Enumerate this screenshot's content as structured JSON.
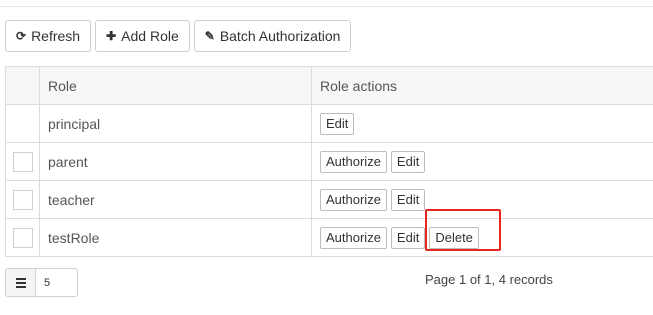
{
  "toolbar": {
    "refresh_label": "Refresh",
    "refresh_icon": "refresh-icon",
    "add_role_label": "Add Role",
    "add_role_icon": "plus-icon",
    "batch_auth_label": "Batch Authorization",
    "batch_auth_icon": "pencil-icon"
  },
  "table": {
    "headers": {
      "role": "Role",
      "actions": "Role actions"
    },
    "rows": [
      {
        "role": "principal",
        "has_checkbox": false,
        "actions": [
          "Edit"
        ]
      },
      {
        "role": "parent",
        "has_checkbox": true,
        "actions": [
          "Authorize",
          "Edit"
        ]
      },
      {
        "role": "teacher",
        "has_checkbox": true,
        "actions": [
          "Authorize",
          "Edit"
        ]
      },
      {
        "role": "testRole",
        "has_checkbox": true,
        "actions": [
          "Authorize",
          "Edit",
          "Delete"
        ]
      }
    ]
  },
  "pagination": {
    "page_size": "5",
    "info": "Page 1 of 1, 4 records"
  },
  "colors": {
    "highlight": "#e8261f"
  }
}
